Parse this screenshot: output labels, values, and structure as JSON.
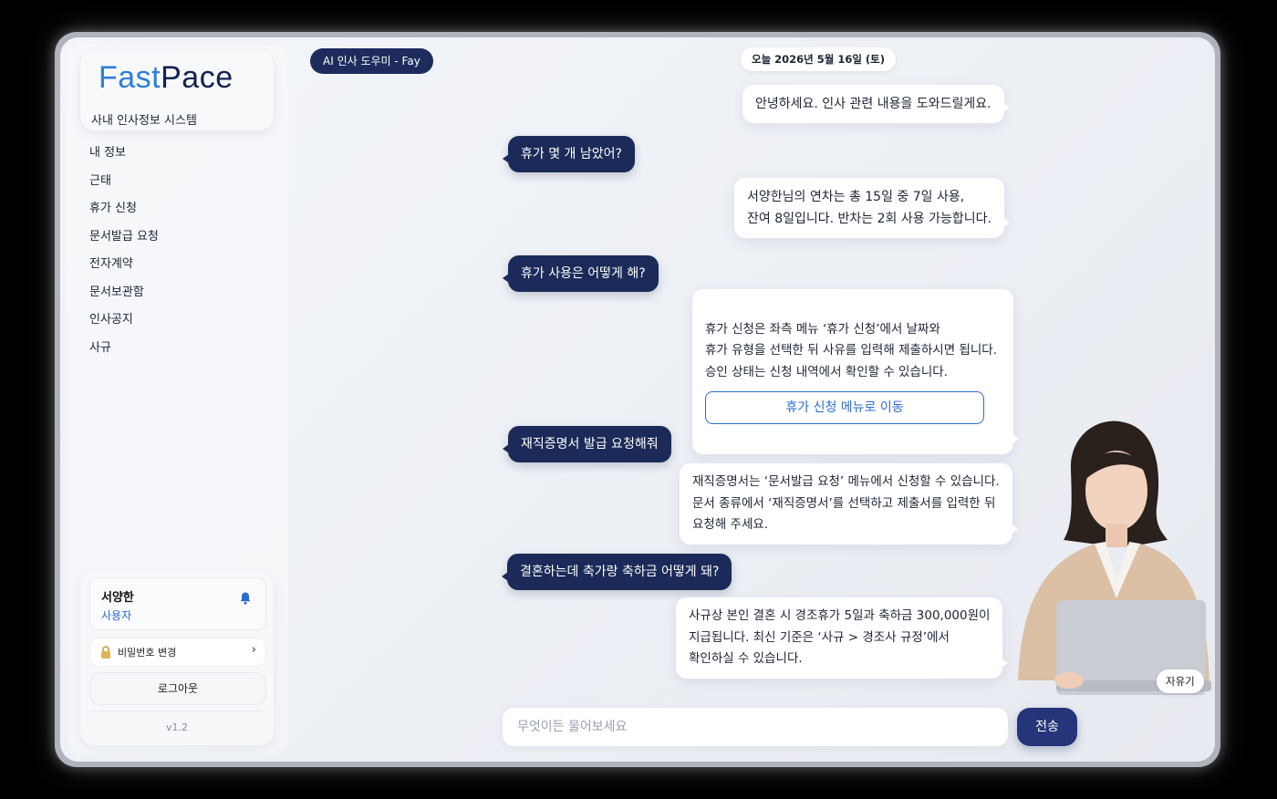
{
  "brand": {
    "logo_part1": "Fast",
    "logo_part2": "Pace",
    "subtitle": "사내 인사정보 시스템"
  },
  "sidebar": {
    "items": [
      {
        "label": "내 정보"
      },
      {
        "label": "근태"
      },
      {
        "label": "휴가 신청"
      },
      {
        "label": "문서발급 요청"
      },
      {
        "label": "전자계약"
      },
      {
        "label": "문서보관함"
      },
      {
        "label": "인사공지"
      },
      {
        "label": "사규"
      }
    ]
  },
  "user": {
    "name": "서양한",
    "role": "사용자",
    "change_password": "비밀번호 변경",
    "logout": "로그아웃",
    "version": "v1.2"
  },
  "chat": {
    "assistant_label": "AI 인사 도우미 - Fay",
    "date": "오늘 2026년 5월 16일 (토)",
    "messages": [
      {
        "role": "bot",
        "text": "안녕하세요. 인사 관련 내용을 도와드릴게요."
      },
      {
        "role": "user",
        "text": "휴가 몇 개 남았어?"
      },
      {
        "role": "bot",
        "text": "서양한님의 연차는 총 15일 중 7일 사용,\n잔여 8일입니다. 반차는 2회 사용 가능합니다."
      },
      {
        "role": "user",
        "text": "휴가 사용은 어떻게 해?"
      },
      {
        "role": "bot",
        "text": "휴가 신청은 좌측 메뉴 ‘휴가 신청’에서 날짜와\n휴가 유형을 선택한 뒤 사유를 입력해 제출하시면 됩니다.\n승인 상태는 신청 내역에서 확인할 수 있습니다.",
        "action": "휴가 신청 메뉴로 이동"
      },
      {
        "role": "user",
        "text": "재직증명서 발급 요청해줘"
      },
      {
        "role": "bot",
        "text": "재직증명서는 ‘문서발급 요청’ 메뉴에서 신청할 수 있습니다.\n문서 종류에서 ‘재직증명서’를 선택하고 제출서를 입력한 뒤\n요청해 주세요."
      },
      {
        "role": "user",
        "text": "결혼하는데 축가랑 축하금 어떻게 돼?"
      },
      {
        "role": "bot",
        "text": "사규상 본인 결혼 시 경조휴가 5일과 축하금 300,000원이\n지급됩니다. 최신 기준은 ‘사규 > 경조사 규정’에서\n확인하실 수 있습니다."
      }
    ],
    "avatar_name": "자유기",
    "input_placeholder": "무엇이든 물어보세요",
    "input_value": "",
    "send_label": "전송"
  },
  "colors": {
    "navy": "#1b2a58",
    "accent_blue": "#2c6bd0",
    "logo_light_blue": "#2e7fd6"
  }
}
